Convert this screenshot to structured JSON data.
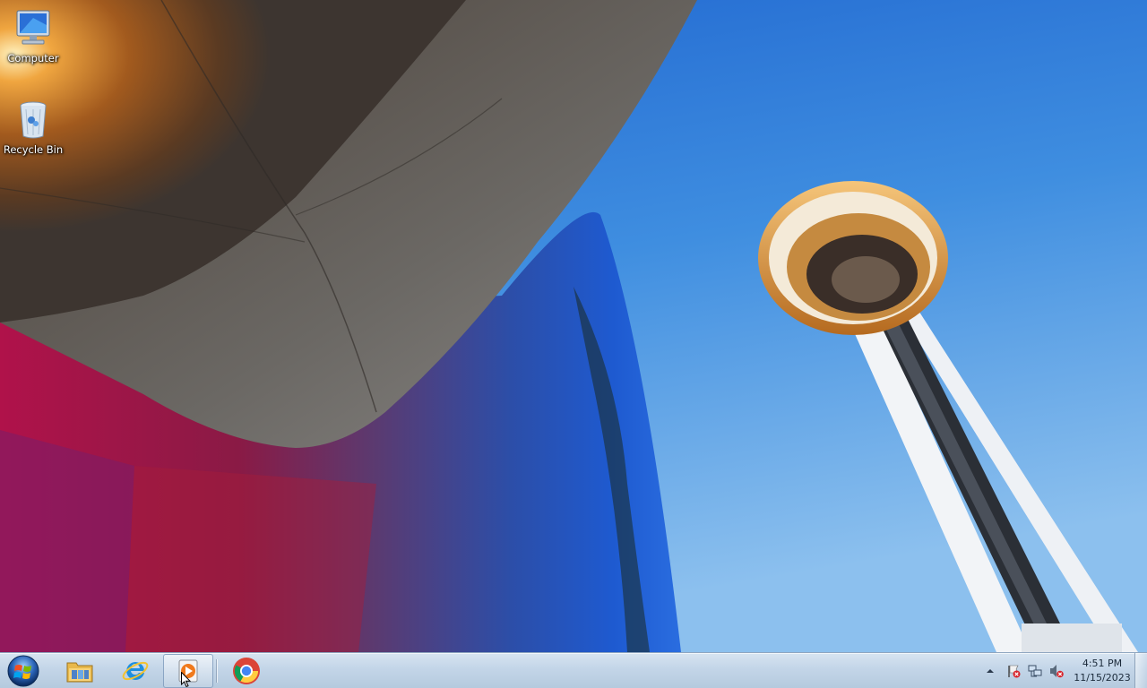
{
  "desktop": {
    "icons": [
      {
        "label": "Computer",
        "icon": "computer-icon"
      },
      {
        "label": "Recycle Bin",
        "icon": "recycle-bin-icon"
      }
    ]
  },
  "taskbar": {
    "start": {
      "icon": "windows-start-orb"
    },
    "pinned": [
      {
        "name": "Windows Explorer",
        "icon": "folder-icon"
      },
      {
        "name": "Internet Explorer",
        "icon": "internet-explorer-icon"
      },
      {
        "name": "Windows Media Player",
        "icon": "media-player-icon",
        "active": true
      },
      {
        "name": "Google Chrome",
        "icon": "chrome-icon"
      }
    ],
    "tray": {
      "icons": [
        "show-hidden-icons-arrow",
        "action-center-flag-icon",
        "network-icon",
        "volume-muted-icon"
      ],
      "time": "4:51 PM",
      "date": "11/15/2023"
    }
  },
  "colors": {
    "sky": "#2f7fd8",
    "taskbar": "#c3d5e8",
    "accent_orange": "#d98a2b"
  }
}
